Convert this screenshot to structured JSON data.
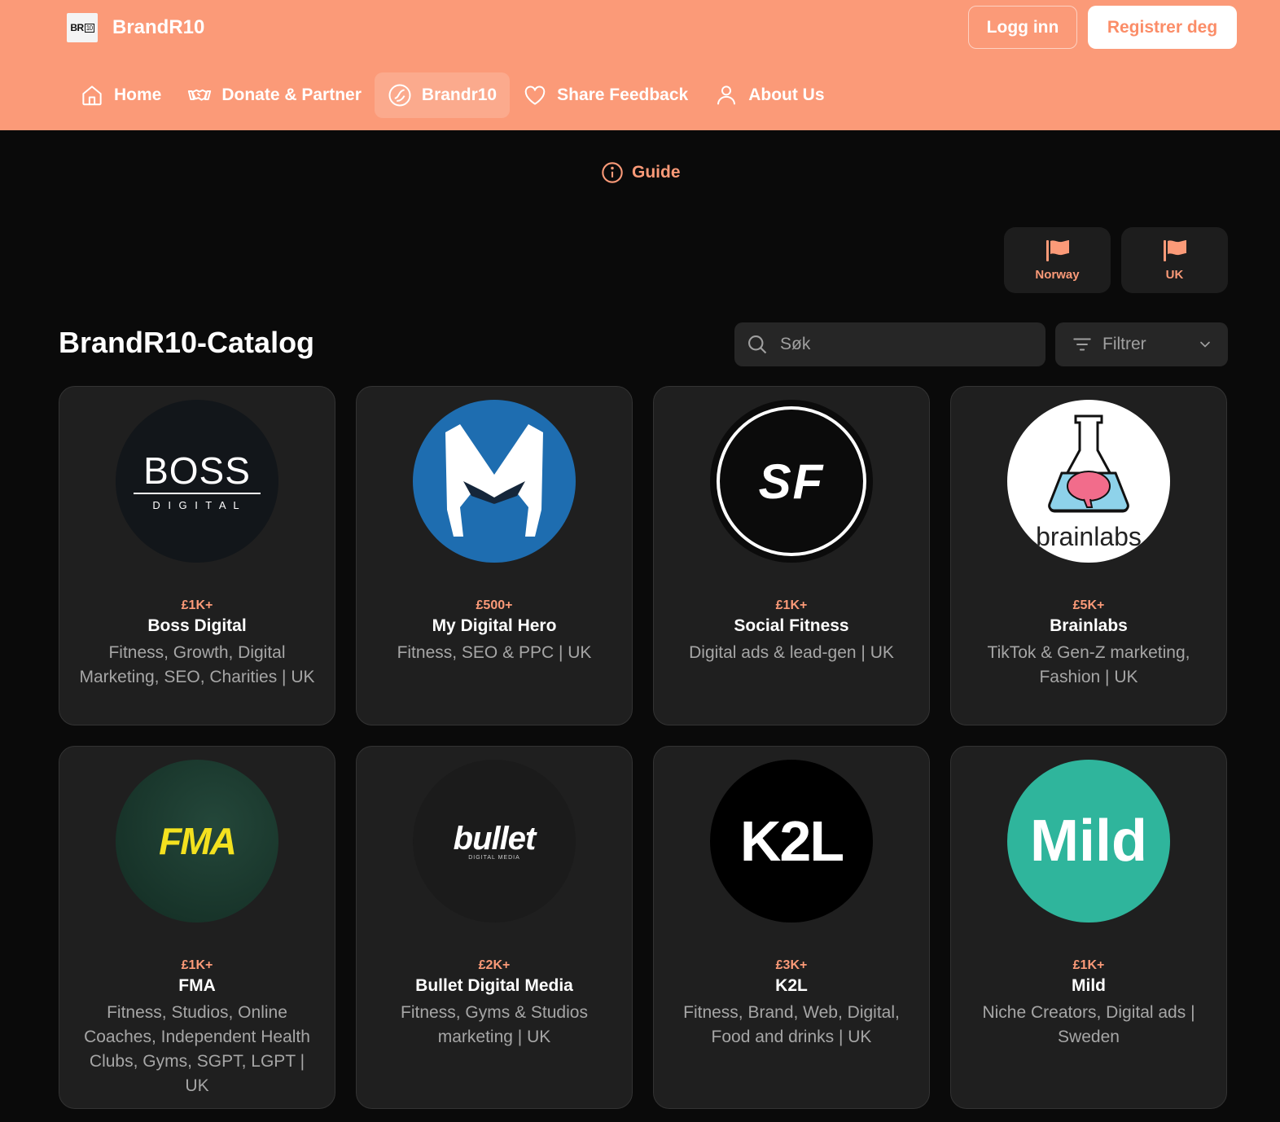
{
  "header": {
    "brand_logo_text": "BR",
    "brand_logo_small": "10",
    "brand_name": "BrandR10",
    "login_label": "Logg inn",
    "register_label": "Registrer deg",
    "accent_color": "#fb9a78"
  },
  "nav": [
    {
      "label": "Home",
      "icon": "home-icon"
    },
    {
      "label": "Donate & Partner",
      "icon": "handshake-icon"
    },
    {
      "label": "Brandr10",
      "icon": "brand-circle-icon",
      "active": true
    },
    {
      "label": "Share Feedback",
      "icon": "heart-icon"
    },
    {
      "label": "About Us",
      "icon": "user-icon"
    }
  ],
  "guide_label": "Guide",
  "countries": [
    {
      "label": "Norway",
      "icon": "flag-icon"
    },
    {
      "label": "UK",
      "icon": "flag-icon"
    }
  ],
  "catalog": {
    "title": "BrandR10-Catalog",
    "search_placeholder": "Søk",
    "filter_label": "Filtrer"
  },
  "cards": [
    {
      "price": "£1K+",
      "name": "Boss Digital",
      "desc": "Fitness, Growth, Digital Marketing, SEO, Charities |  UK",
      "logo_text": "BOSS",
      "logo_sub": "D I G I T A L"
    },
    {
      "price": "£500+",
      "name": "My Digital Hero",
      "desc": "Fitness, SEO & PPC |  UK",
      "logo_text": ""
    },
    {
      "price": "£1K+",
      "name": "Social Fitness",
      "desc": "Digital ads & lead-gen |  UK",
      "logo_text": "SF"
    },
    {
      "price": "£5K+",
      "name": "Brainlabs",
      "desc": "TikTok & Gen-Z marketing, Fashion |  UK",
      "logo_text": "brainlabs"
    },
    {
      "price": "£1K+",
      "name": "FMA",
      "desc": "Fitness, Studios, Online Coaches, Independent Health Clubs, Gyms, SGPT, LGPT |  UK",
      "logo_text": "FMA"
    },
    {
      "price": "£2K+",
      "name": "Bullet Digital Media",
      "desc": "Fitness, Gyms & Studios marketing |  UK",
      "logo_text": "bullet",
      "logo_sub": "DIGITAL MEDIA"
    },
    {
      "price": "£3K+",
      "name": "K2L",
      "desc": "Fitness, Brand, Web, Digital, Food and drinks |  UK",
      "logo_text": "K2L"
    },
    {
      "price": "£1K+",
      "name": "Mild",
      "desc": "Niche Creators, Digital ads |  Sweden",
      "logo_text": "Mild"
    }
  ]
}
